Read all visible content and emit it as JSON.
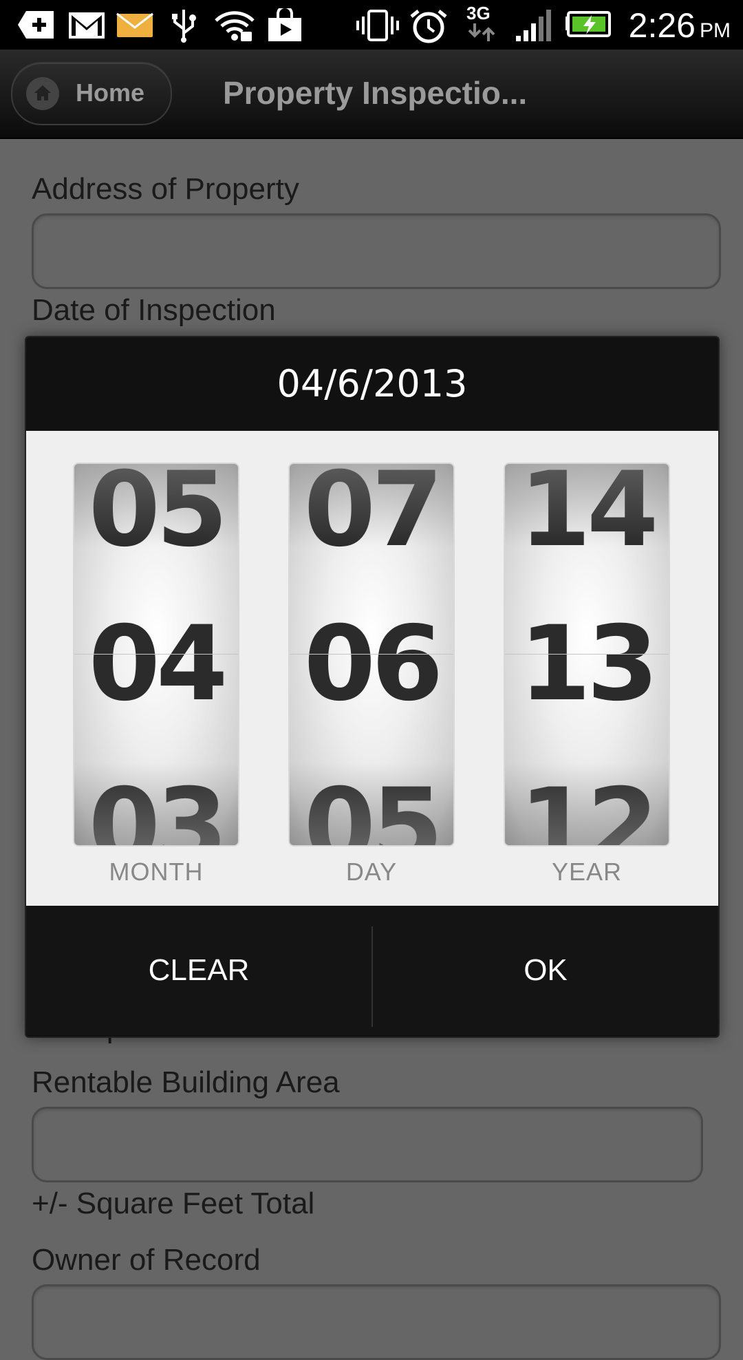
{
  "status_bar": {
    "time": "2:26",
    "ampm": "PM",
    "network_label": "3G",
    "icons": [
      "plus-notification-icon",
      "gmail-icon",
      "email-icon",
      "usb-icon",
      "wifi-hotspot-icon",
      "play-store-icon",
      "vibrate-icon",
      "alarm-icon",
      "network-3g-icon",
      "signal-icon",
      "battery-charging-icon"
    ]
  },
  "header": {
    "home_label": "Home",
    "title": "Property Inspectio..."
  },
  "form": {
    "address_label": "Address of Property",
    "date_label": "Date of Inspection",
    "hidden_sqft_label": "+/- Square Feet Total",
    "rentable_label": "Rentable Building Area",
    "sqft_label": "+/- Square Feet Total",
    "owner_label": "Owner of Record"
  },
  "date_dialog": {
    "title": "04/6/2013",
    "month": {
      "prev": "05",
      "current": "04",
      "next": "03",
      "label": "MONTH"
    },
    "day": {
      "prev": "07",
      "current": "06",
      "next": "05",
      "label": "DAY"
    },
    "year": {
      "prev": "14",
      "current": "13",
      "next": "12",
      "label": "YEAR"
    },
    "clear_label": "CLEAR",
    "ok_label": "OK"
  },
  "colors": {
    "overlay_bg": "#666666",
    "dialog_bg": "#111111",
    "wheel_text": "#2b2b2b"
  }
}
